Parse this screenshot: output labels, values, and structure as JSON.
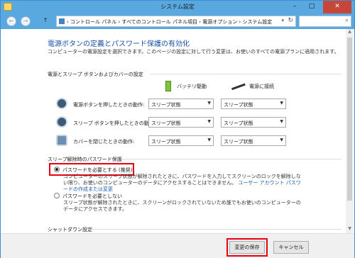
{
  "window": {
    "title": "システム設定",
    "min": "–",
    "max": "□",
    "close": "✕"
  },
  "nav": {
    "back": "←",
    "forward": "→",
    "up": "↑",
    "breadcrumb": "›  コントロール パネル  ›  すべてのコントロール パネル項目  ›  電源オプション  ›  システム設定",
    "dropdown": "▾",
    "refresh": "↻",
    "search_icon": "⌕"
  },
  "page": {
    "heading": "電源ボタンの定義とパスワード保護の有効化",
    "description": "コンピューターの電源設定を選択できます。このページの設定に対して行う変更は、お使いのすべての電源プランに適用されます。",
    "section_buttons": "電源とスリープ ボタンおよびカバーの設定",
    "col_battery": "バッテリ駆動",
    "col_plugged": "電源に接続",
    "rows": [
      {
        "label": "電源ボタンを押したときの動作:",
        "battery": "スリープ状態",
        "plugged": "スリープ状態"
      },
      {
        "label": "スリープ ボタンを押したときの動作:",
        "battery": "スリープ状態",
        "plugged": "スリープ状態"
      },
      {
        "label": "カバーを閉じたときの動作:",
        "battery": "スリープ状態",
        "plugged": "スリープ状態"
      }
    ],
    "section_password": "スリープ解除時のパスワード保護",
    "opt_require": "パスワードを必要とする (推奨)",
    "opt_require_note": "コンピューターのスリープ状態が解除されたときに、パスワードを入力してスクリーンのロックを解除しない限り、お使いのコンピューターのデータにアクセスすることはできません。",
    "opt_require_link": "ユーザー アカウント パスワードの作成または変更",
    "opt_none": "パスワードを必要としない",
    "opt_none_note": "スリープ状態が解除されたときに、スクリーンがロックされていないため誰でもお使いのコンピューターのデータにアクセスできます。",
    "section_shutdown": "シャットダウン設定"
  },
  "footer": {
    "save": "変更の保存",
    "cancel": "キャンセル"
  },
  "colors": {
    "titlebar": "#5aa8e0",
    "heading": "#1a4fa5",
    "highlight": "#e60012",
    "link": "#1a5fb4"
  }
}
